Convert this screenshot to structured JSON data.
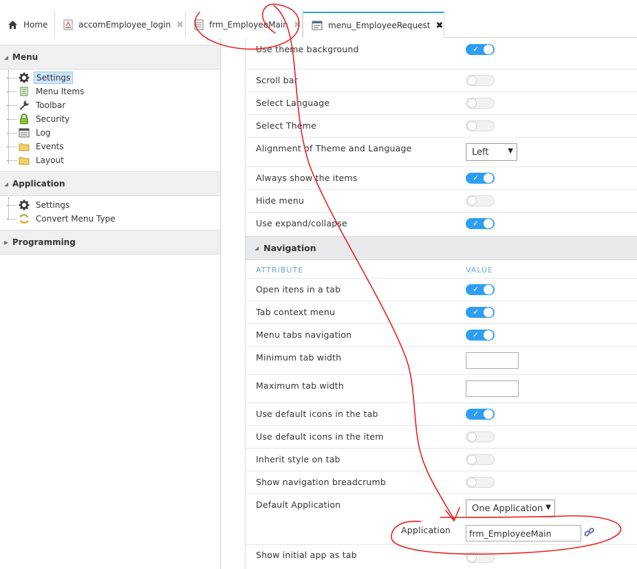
{
  "tabs": [
    {
      "label": "Home",
      "icon": "home-icon",
      "closable": false
    },
    {
      "label": "accomEmployee_login",
      "icon": "form-icon",
      "closable": true
    },
    {
      "label": "frm_EmployeeMain",
      "icon": "document-icon",
      "closable": true
    },
    {
      "label": "menu_EmployeeRequest",
      "icon": "menu-icon",
      "closable": true,
      "active": true
    }
  ],
  "sidebar": {
    "menu_section": {
      "title": "Menu",
      "items": [
        {
          "label": "Settings",
          "icon": "gear-icon",
          "selected": true
        },
        {
          "label": "Menu Items",
          "icon": "menu-items-icon"
        },
        {
          "label": "Toolbar",
          "icon": "wrench-icon"
        },
        {
          "label": "Security",
          "icon": "lock-icon"
        },
        {
          "label": "Log",
          "icon": "log-icon"
        },
        {
          "label": "Events",
          "icon": "folder-icon"
        },
        {
          "label": "Layout",
          "icon": "folder-icon"
        }
      ]
    },
    "application_section": {
      "title": "Application",
      "items": [
        {
          "label": "Settings",
          "icon": "gear-icon"
        },
        {
          "label": "Convert Menu Type",
          "icon": "refresh-icon"
        }
      ]
    },
    "programming_section": {
      "title": "Programming"
    }
  },
  "settings": {
    "top_rows": [
      {
        "label": "Use theme background",
        "control": "toggle",
        "value": "on"
      },
      {
        "label": "Scroll bar",
        "control": "toggle",
        "value": "off"
      },
      {
        "label": "Select Language",
        "control": "toggle",
        "value": "off"
      },
      {
        "label": "Select Theme",
        "control": "toggle",
        "value": "off"
      },
      {
        "label": "Alignment of Theme and Language",
        "control": "select",
        "value": "Left"
      },
      {
        "label": "Always show the items",
        "control": "toggle",
        "value": "on"
      },
      {
        "label": "Hide menu",
        "control": "toggle",
        "value": "off"
      },
      {
        "label": "Use expand/collapse",
        "control": "toggle",
        "value": "on"
      }
    ],
    "navigation": {
      "title": "Navigation",
      "col_attribute": "ATTRIBUTE",
      "col_value": "VALUE",
      "rows": [
        {
          "label": "Open itens in a tab",
          "control": "toggle",
          "value": "on"
        },
        {
          "label": "Tab context menu",
          "control": "toggle",
          "value": "on"
        },
        {
          "label": "Menu tabs navigation",
          "control": "toggle",
          "value": "on"
        },
        {
          "label": "Minimum tab width",
          "control": "text",
          "value": ""
        },
        {
          "label": "Maximum tab width",
          "control": "text",
          "value": ""
        },
        {
          "label": "Use default icons in the tab",
          "control": "toggle",
          "value": "on"
        },
        {
          "label": "Use default icons in the item",
          "control": "toggle",
          "value": "off"
        },
        {
          "label": "Inherit style on tab",
          "control": "toggle",
          "value": "off"
        },
        {
          "label": "Show navigation breadcrumb",
          "control": "toggle",
          "value": "off"
        }
      ],
      "default_application": {
        "label": "Default Application",
        "select_value": "One Application",
        "sub_label": "Application",
        "app_value": "frm_EmployeeMain"
      },
      "last_row": {
        "label": "Show initial app as tab",
        "control": "toggle",
        "value": "off"
      }
    }
  },
  "colors": {
    "toggle_on": "#2e9ff0",
    "active_tab_accent": "#2aa4e6",
    "annotation_red": "#e8201e"
  }
}
